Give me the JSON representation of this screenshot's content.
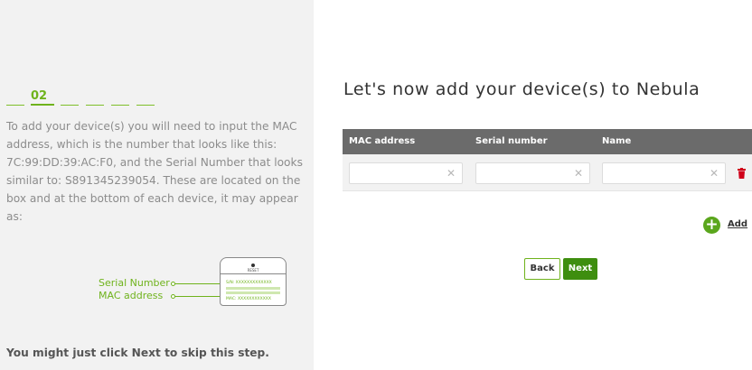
{
  "left_panel": {
    "step_number": "02",
    "description": "To add your device(s) you will need to input the MAC address, which is the number that looks like this: 7C:99:DD:39:AC:F0, and the Serial Number that looks similar to: S891345239054. These are located on the box and at the bottom of each device, it may appear as:",
    "diagram": {
      "serial_label": "Serial Number",
      "mac_label": "MAC address",
      "device_reset": "RESET",
      "device_sn": "S/N: XXXXXXXXXXXXX",
      "device_mac": "MAC: XXXXXXXXXXXX"
    },
    "skip_text": "You might just click Next to skip this step."
  },
  "main": {
    "title": "Let's now add your device(s) to Nebula",
    "table": {
      "headers": [
        "MAC address",
        "Serial number",
        "Name"
      ],
      "row": {
        "mac": "",
        "serial": "",
        "name": ""
      }
    },
    "add_label": "Add",
    "back_label": "Back",
    "next_label": "Next"
  },
  "colors": {
    "accent_green": "#6fb31c",
    "next_button": "#3e8e0f",
    "header_gray": "#6b6b6b",
    "trash_red": "#d0021b"
  },
  "icons": [
    "clear-icon",
    "trash-icon",
    "add-circle-icon"
  ]
}
